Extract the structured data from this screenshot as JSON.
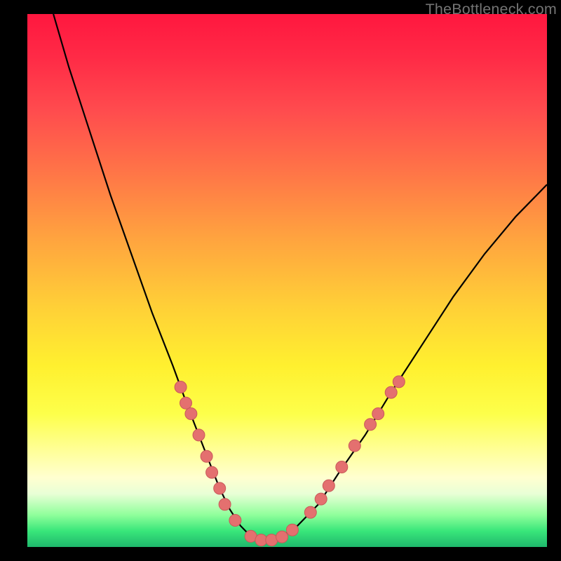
{
  "watermark": "TheBottleneck.com",
  "colors": {
    "page_bg": "#000000",
    "curve": "#000000",
    "dot_fill": "#e4706f",
    "dot_stroke": "#c95a5a",
    "watermark": "#747474"
  },
  "chart_data": {
    "type": "line",
    "title": "",
    "xlabel": "",
    "ylabel": "",
    "xlim": [
      0,
      100
    ],
    "ylim": [
      0,
      100
    ],
    "grid": false,
    "legend": false,
    "annotations": [],
    "series": [
      {
        "name": "bottleneck-curve",
        "x": [
          5,
          8,
          12,
          16,
          20,
          24,
          28,
          31,
          33,
          35,
          37,
          39,
          41,
          43,
          45,
          47,
          49,
          52,
          56,
          60,
          65,
          70,
          76,
          82,
          88,
          94,
          100
        ],
        "y": [
          100,
          90,
          78,
          66,
          55,
          44,
          34,
          26,
          21,
          16,
          11,
          7,
          4,
          2,
          1,
          1,
          2,
          4,
          8,
          14,
          21,
          29,
          38,
          47,
          55,
          62,
          68
        ]
      }
    ],
    "markers": {
      "name": "highlight-dots",
      "points": [
        {
          "x": 29.5,
          "y": 30
        },
        {
          "x": 30.5,
          "y": 27
        },
        {
          "x": 31.5,
          "y": 25
        },
        {
          "x": 33.0,
          "y": 21
        },
        {
          "x": 34.5,
          "y": 17
        },
        {
          "x": 35.5,
          "y": 14
        },
        {
          "x": 37.0,
          "y": 11
        },
        {
          "x": 38.0,
          "y": 8
        },
        {
          "x": 40.0,
          "y": 5
        },
        {
          "x": 43.0,
          "y": 2
        },
        {
          "x": 45.0,
          "y": 1.3
        },
        {
          "x": 47.0,
          "y": 1.3
        },
        {
          "x": 49.0,
          "y": 1.9
        },
        {
          "x": 51.0,
          "y": 3.2
        },
        {
          "x": 54.5,
          "y": 6.5
        },
        {
          "x": 56.5,
          "y": 9
        },
        {
          "x": 58.0,
          "y": 11.5
        },
        {
          "x": 60.5,
          "y": 15
        },
        {
          "x": 63.0,
          "y": 19
        },
        {
          "x": 66.0,
          "y": 23
        },
        {
          "x": 67.5,
          "y": 25
        },
        {
          "x": 70.0,
          "y": 29
        },
        {
          "x": 71.5,
          "y": 31
        }
      ]
    }
  }
}
